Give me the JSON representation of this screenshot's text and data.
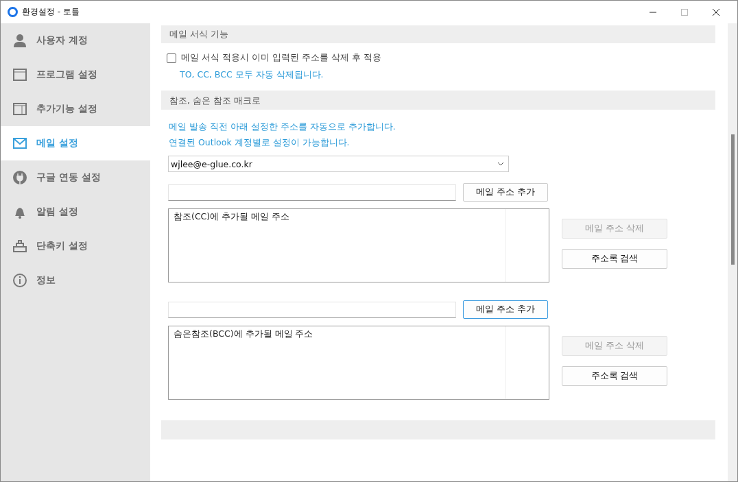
{
  "window": {
    "title": "환경설정 - 토틀"
  },
  "sidebar": {
    "items": [
      {
        "label": "사용자 계정",
        "selected": false
      },
      {
        "label": "프로그램 설정",
        "selected": false
      },
      {
        "label": "추가기능 설정",
        "selected": false
      },
      {
        "label": "메일 설정",
        "selected": true
      },
      {
        "label": "구글 연동 설정",
        "selected": false
      },
      {
        "label": "알림 설정",
        "selected": false
      },
      {
        "label": "단축키 설정",
        "selected": false
      },
      {
        "label": "정보",
        "selected": false
      }
    ]
  },
  "format_section": {
    "heading": "메일 서식 기능",
    "checkbox": {
      "label": "메일 서식 적용시 이미 입력된 주소를 삭제 후 적용",
      "checked": false
    },
    "note": "TO, CC, BCC 모두 자동 삭제됩니다."
  },
  "macro_section": {
    "heading": "참조, 숨은 참조 매크로",
    "notes": [
      "메일 발송 직전 아래 설정한 주소를 자동으로 추가합니다.",
      "연결된 Outlook 계정별로 설정이 가능합니다."
    ],
    "account_dropdown": {
      "value": "wjlee@e-glue.co.kr"
    },
    "groups": [
      {
        "add_button": {
          "label": "메일 주소 추가",
          "focused": false
        },
        "list_placeholder": "참조(CC)에 추가될 메일 주소",
        "delete_button": {
          "label": "메일 주소 삭제",
          "disabled": true
        },
        "search_button": {
          "label": "주소록 검색",
          "disabled": false
        }
      },
      {
        "add_button": {
          "label": "메일 주소 추가",
          "focused": true
        },
        "list_placeholder": "숨은참조(BCC)에 추가될 메일 주소",
        "delete_button": {
          "label": "메일 주소 삭제",
          "disabled": true
        },
        "search_button": {
          "label": "주소록 검색",
          "disabled": false
        }
      }
    ]
  }
}
